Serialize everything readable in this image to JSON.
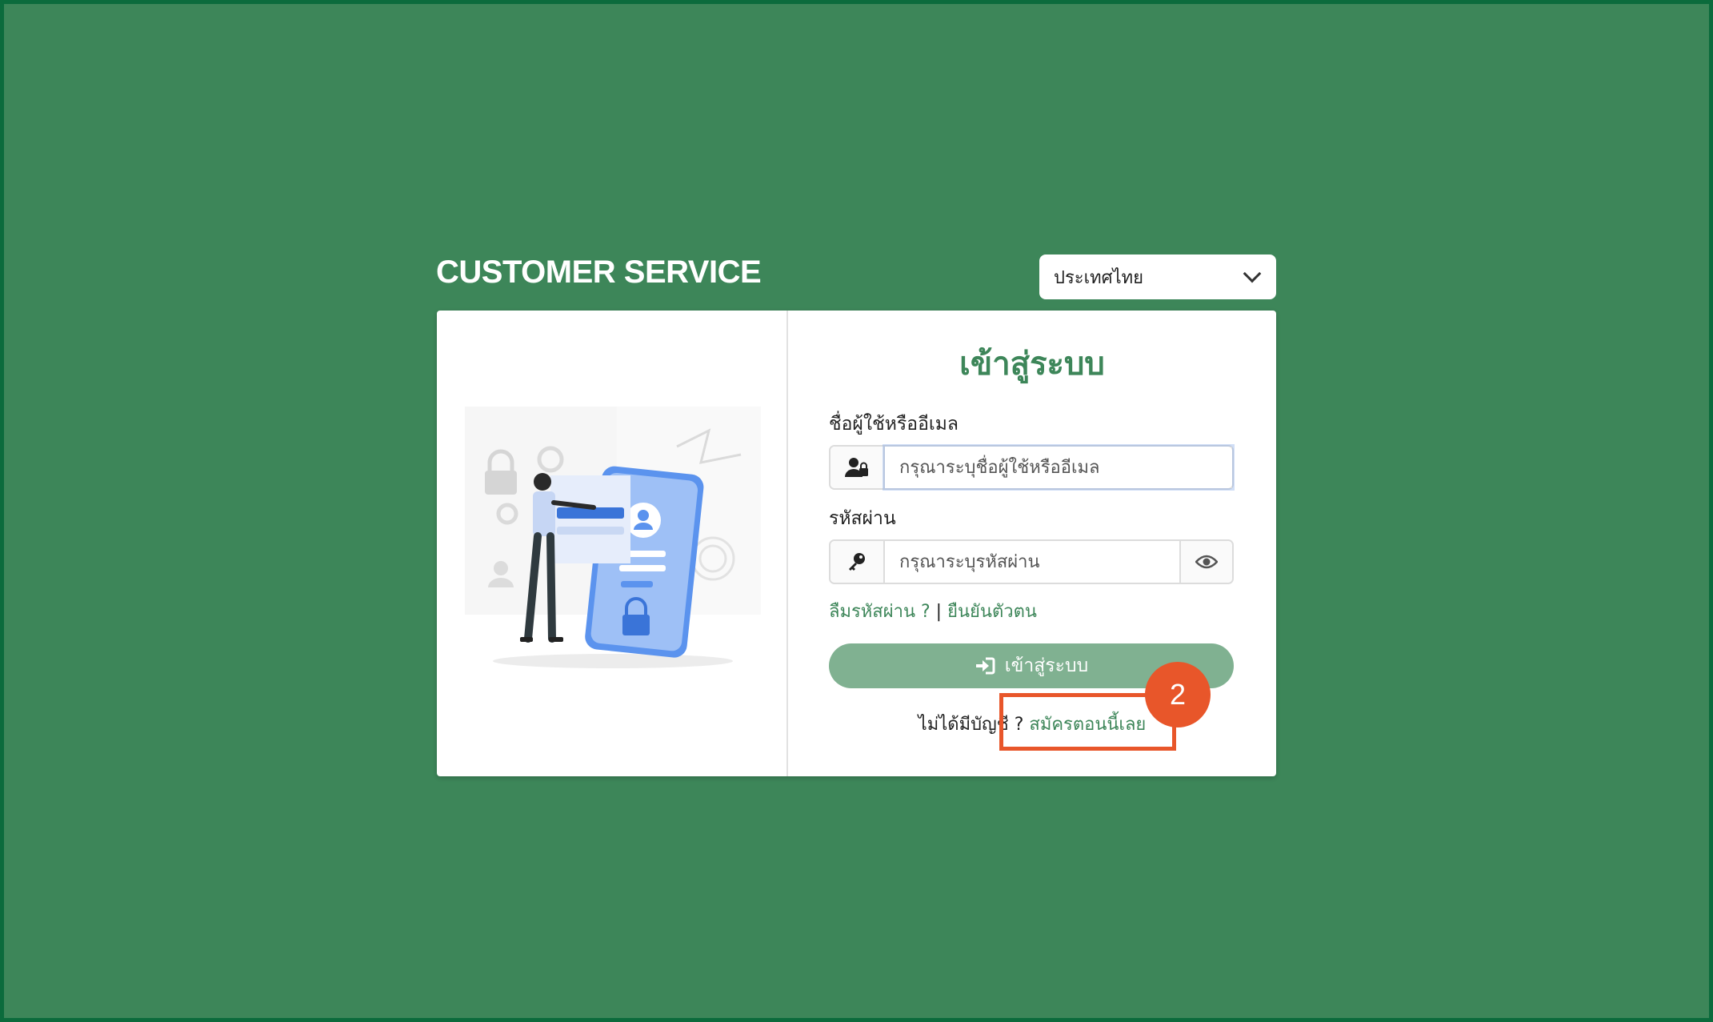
{
  "header": {
    "brand": "CUSTOMER SERVICE"
  },
  "language": {
    "selected": "ประเทศไทย"
  },
  "login": {
    "title": "เข้าสู่ระบบ",
    "username_label": "ชื่อผู้ใช้หรืออีเมล",
    "username_placeholder": "กรุณาระบุชื่อผู้ใช้หรืออีเมล",
    "password_label": "รหัสผ่าน",
    "password_placeholder": "กรุณาระบุรหัสผ่าน",
    "forgot_password": "ลืมรหัสผ่าน ?",
    "separator": " | ",
    "verify_identity": "ยืนยันตัวตน",
    "submit_label": "เข้าสู่ระบบ",
    "no_account_text": "ไม่ได้มีบัญชี ? ",
    "signup_link": "สมัครตอนนี้เลย"
  },
  "annotation": {
    "step_number": "2",
    "color": "#e8562a"
  },
  "colors": {
    "background": "#3d8659",
    "accent": "#3d8659",
    "button": "#80b191"
  },
  "icons": [
    "user-lock-icon",
    "key-icon",
    "eye-icon",
    "sign-in-icon",
    "chevron-down-icon"
  ]
}
